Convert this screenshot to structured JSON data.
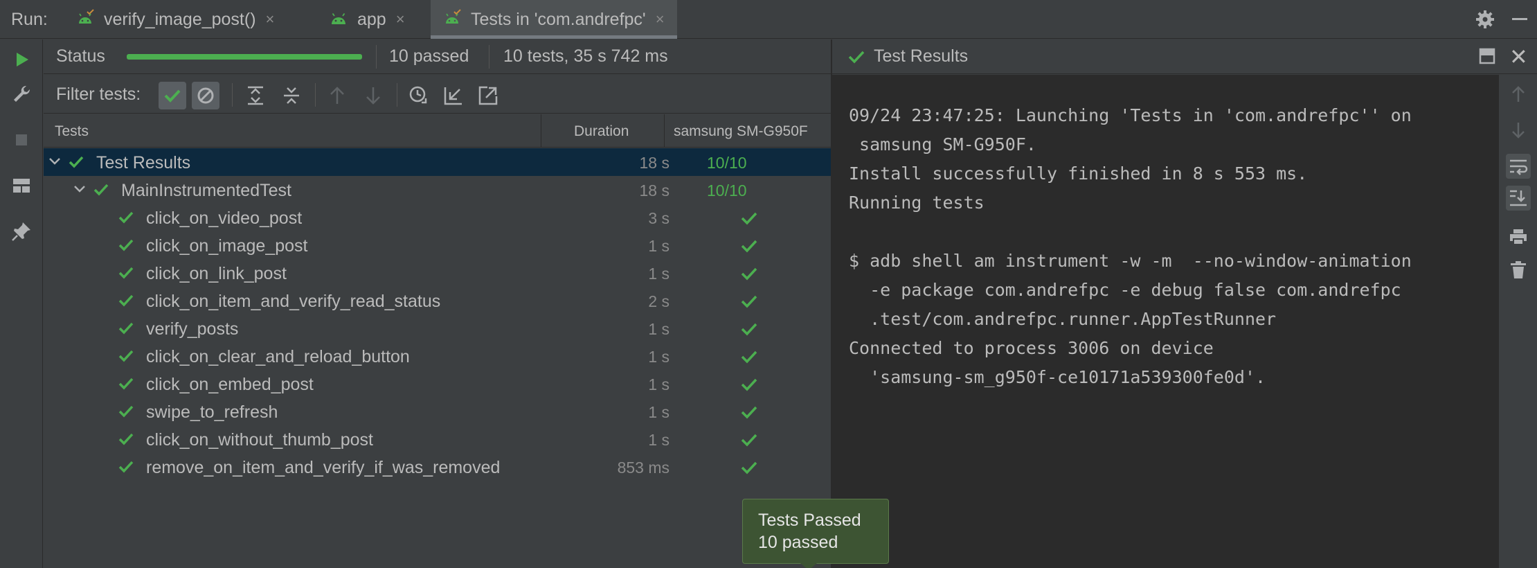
{
  "run_bar": {
    "label": "Run:",
    "tabs": [
      {
        "label": "verify_image_post()",
        "active": false,
        "closable": true
      },
      {
        "label": "app",
        "active": false,
        "closable": true
      },
      {
        "label": "Tests in 'com.andrefpc'",
        "active": true,
        "closable": true
      }
    ],
    "close_glyph": "×",
    "icons": {
      "settings": "gear-icon",
      "minimize": "minimize-icon"
    }
  },
  "left_toolbar": [
    "rerun-icon",
    "wrench-icon",
    "stop-icon",
    "layout-icon",
    "pin-icon"
  ],
  "status": {
    "label": "Status",
    "progress_fraction": 1.0,
    "passed": "10 passed",
    "summary": "10 tests, 35 s 742 ms"
  },
  "filter": {
    "label": "Filter tests:",
    "tools": [
      "show-passed-icon",
      "show-ignored-icon",
      "expand-all-icon",
      "collapse-all-icon",
      "previous-failed-icon",
      "next-failed-icon",
      "test-history-icon",
      "import-tests-icon",
      "export-tests-icon"
    ]
  },
  "tree_header": {
    "tests": "Tests",
    "duration": "Duration",
    "device": "samsung  SM-G950F"
  },
  "tree": {
    "root": {
      "name": "Test Results",
      "duration": "18 s",
      "result": "10/10"
    },
    "suite": {
      "name": "MainInstrumentedTest",
      "duration": "18 s",
      "result": "10/10"
    },
    "tests": [
      {
        "name": "click_on_video_post",
        "duration": "3 s"
      },
      {
        "name": "click_on_image_post",
        "duration": "1 s"
      },
      {
        "name": "click_on_link_post",
        "duration": "1 s"
      },
      {
        "name": "click_on_item_and_verify_read_status",
        "duration": "2 s"
      },
      {
        "name": "verify_posts",
        "duration": "1 s"
      },
      {
        "name": "click_on_clear_and_reload_button",
        "duration": "1 s"
      },
      {
        "name": "click_on_embed_post",
        "duration": "1 s"
      },
      {
        "name": "swipe_to_refresh",
        "duration": "1 s"
      },
      {
        "name": "click_on_without_thumb_post",
        "duration": "1 s"
      },
      {
        "name": "remove_on_item_and_verify_if_was_removed",
        "duration": "853 ms"
      }
    ]
  },
  "results_panel": {
    "title": "Test Results",
    "close_glyph": "✕",
    "console_lines": [
      "09/24 23:47:25: Launching 'Tests in 'com.andrefpc'' on",
      " samsung SM-G950F.",
      "Install successfully finished in 8 s 553 ms.",
      "Running tests",
      "",
      "$ adb shell am instrument -w -m  --no-window-animation",
      "  -e package com.andrefpc -e debug false com.andrefpc",
      "  .test/com.andrefpc.runner.AppTestRunner",
      "Connected to process 3006 on device",
      "  'samsung-sm_g950f-ce10171a539300fe0d'."
    ],
    "console_tools": [
      "scroll-up-icon",
      "scroll-down-icon",
      "soft-wrap-icon",
      "scroll-to-end-icon",
      "print-icon",
      "clear-icon"
    ]
  },
  "tooltip": {
    "title": "Tests Passed",
    "detail": "10 passed"
  },
  "colors": {
    "pass_green": "#4caf50",
    "selection": "#0d293e",
    "console_bg": "#2b2b2b",
    "panel_bg": "#3c3f41",
    "tooltip_bg": "#3d5433"
  }
}
